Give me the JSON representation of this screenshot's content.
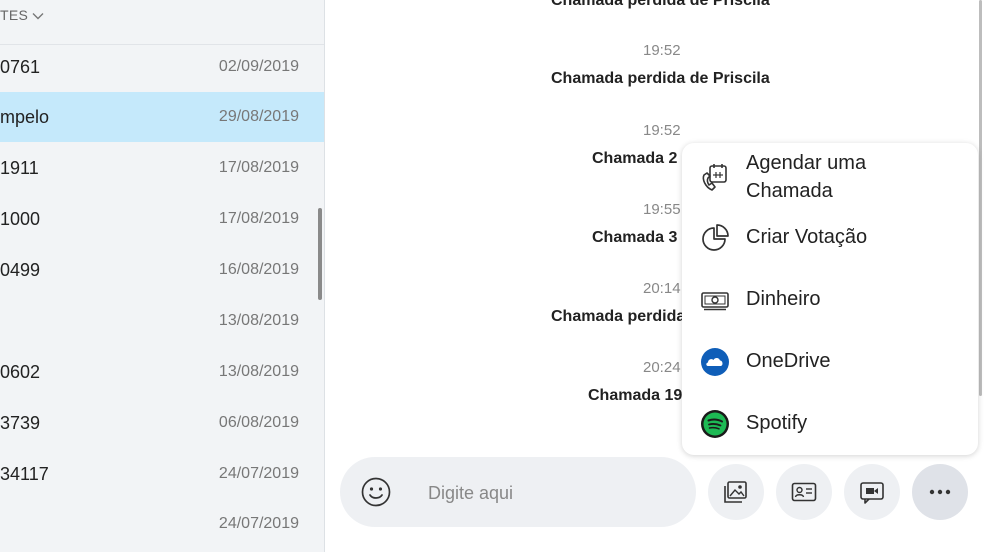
{
  "sidebar": {
    "header_label": "TES",
    "rows": [
      {
        "name": "0761",
        "date": "02/09/2019"
      },
      {
        "name": "mpelo",
        "date": "29/08/2019"
      },
      {
        "name": "1911",
        "date": "17/08/2019"
      },
      {
        "name": "1000",
        "date": "17/08/2019"
      },
      {
        "name": "0499",
        "date": "16/08/2019"
      },
      {
        "name": "",
        "date": "13/08/2019"
      },
      {
        "name": "0602",
        "date": "13/08/2019"
      },
      {
        "name": "3739",
        "date": "06/08/2019"
      },
      {
        "name": "34117",
        "date": "24/07/2019"
      },
      {
        "name": "",
        "date": "24/07/2019"
      }
    ]
  },
  "chat": {
    "messages": [
      {
        "time": "",
        "text": "Chamada perdida de Priscila"
      },
      {
        "time": "19:52",
        "text": "Chamada perdida de Priscila"
      },
      {
        "time": "19:52",
        "text": "Chamada 2"
      },
      {
        "time": "19:55",
        "text": "Chamada 3"
      },
      {
        "time": "20:14",
        "text": "Chamada perdida"
      },
      {
        "time": "20:24",
        "text": "Chamada 19"
      }
    ]
  },
  "menu": {
    "items": [
      {
        "label_line1": "Agendar uma",
        "label_line2": "Chamada",
        "icon": "schedule-call-icon"
      },
      {
        "label": "Criar Votação",
        "icon": "poll-icon"
      },
      {
        "label": "Dinheiro",
        "icon": "money-icon"
      },
      {
        "label": "OneDrive",
        "icon": "onedrive-icon"
      },
      {
        "label": "Spotify",
        "icon": "spotify-icon"
      }
    ]
  },
  "composer": {
    "placeholder": "Digite aqui"
  },
  "colors": {
    "selected_row": "#c5e9fb",
    "onedrive": "#0f5eb8",
    "spotify": "#1db954"
  }
}
